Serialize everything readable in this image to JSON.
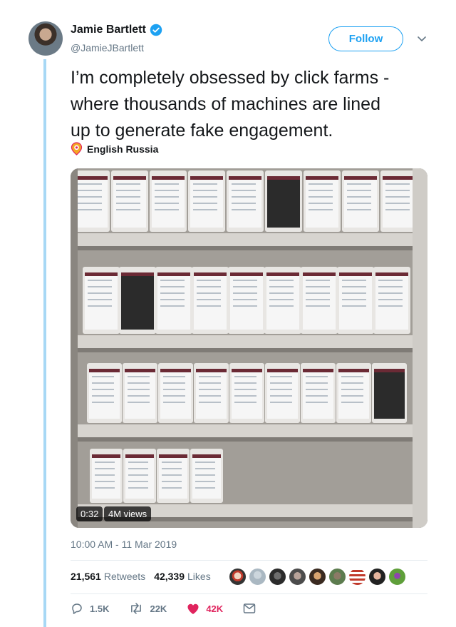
{
  "author": {
    "name": "Jamie Bartlett",
    "handle": "@JamieJBartlett",
    "verified": true,
    "avatar_icon": "user-avatar"
  },
  "follow_label": "Follow",
  "tweet": {
    "line1": "I’m completely obsessed by click farms -",
    "line2": "where thousands of machines are lined",
    "line3": "up to generate fake engagement."
  },
  "location": {
    "icon": "location-pin-icon",
    "label": "English Russia"
  },
  "media": {
    "duration": "0:32",
    "views": "4M views"
  },
  "timestamp": "10:00 AM - 11 Mar 2019",
  "stats": {
    "retweets": "21,561",
    "retweets_label": "Retweets",
    "likes": "42,339",
    "likes_label": "Likes"
  },
  "actions": {
    "reply": "1.5K",
    "retweet": "22K",
    "like": "42K"
  },
  "colors": {
    "accent": "#1da1f2",
    "like": "#e0245e",
    "thread_line": "#a7d8f5",
    "muted": "#657786"
  }
}
